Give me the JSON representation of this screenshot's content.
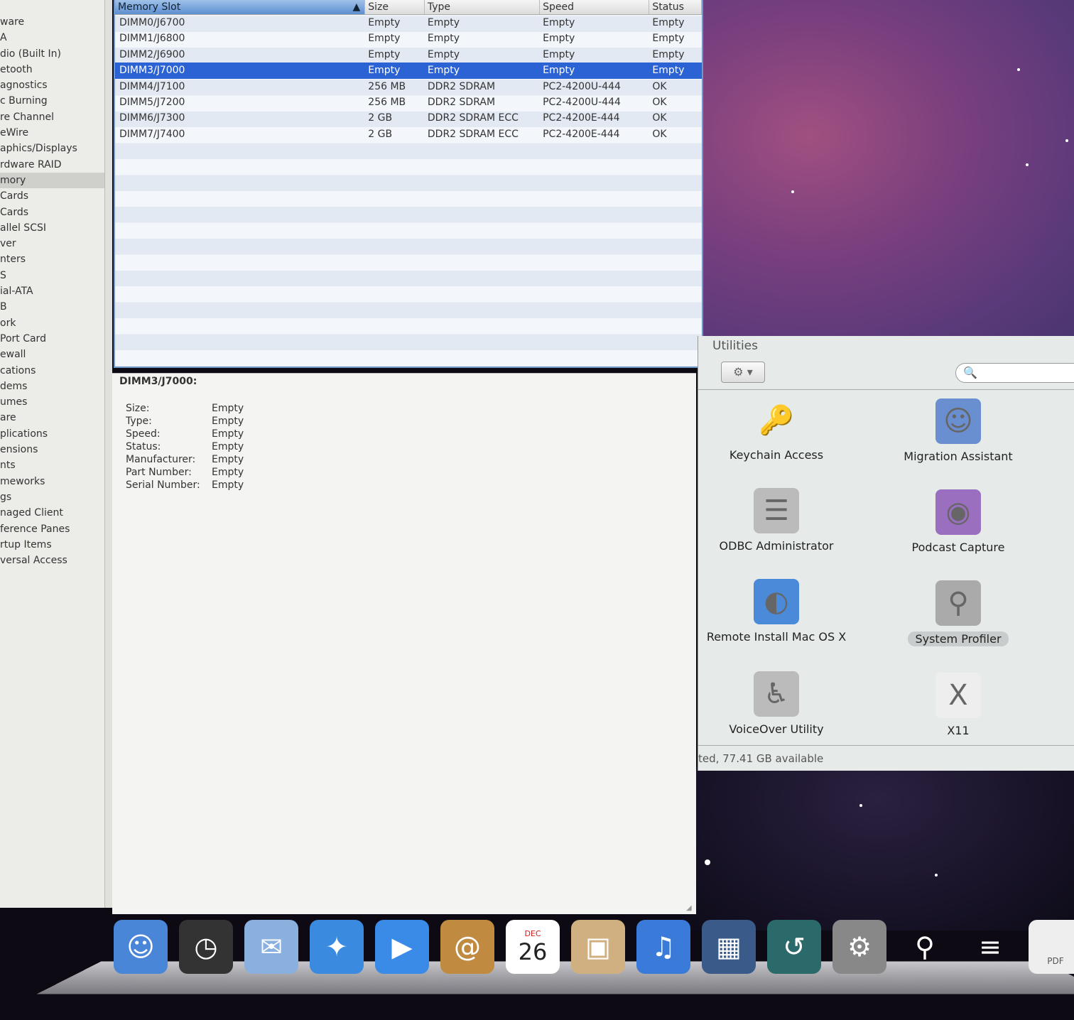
{
  "sidebar": {
    "items": [
      "ware",
      "A",
      "dio (Built In)",
      "etooth",
      "agnostics",
      "c Burning",
      "re Channel",
      "eWire",
      "aphics/Displays",
      "rdware RAID",
      "mory",
      "Cards",
      "Cards",
      "allel SCSI",
      "ver",
      "nters",
      "S",
      "ial-ATA",
      "B",
      "ork",
      "Port Card",
      "ewall",
      "cations",
      "dems",
      "umes",
      "are",
      "plications",
      "ensions",
      "nts",
      "meworks",
      "gs",
      "naged Client",
      "ference Panes",
      "rtup Items",
      "versal Access"
    ],
    "selected": "mory"
  },
  "table": {
    "columns": [
      "Memory Slot",
      "Size",
      "Type",
      "Speed",
      "Status"
    ],
    "sort_icon": "sort-ascending-icon",
    "rows": [
      [
        "DIMM0/J6700",
        "Empty",
        "Empty",
        "Empty",
        "Empty"
      ],
      [
        "DIMM1/J6800",
        "Empty",
        "Empty",
        "Empty",
        "Empty"
      ],
      [
        "DIMM2/J6900",
        "Empty",
        "Empty",
        "Empty",
        "Empty"
      ],
      [
        "DIMM3/J7000",
        "Empty",
        "Empty",
        "Empty",
        "Empty"
      ],
      [
        "DIMM4/J7100",
        "256 MB",
        "DDR2 SDRAM",
        "PC2-4200U-444",
        "OK"
      ],
      [
        "DIMM5/J7200",
        "256 MB",
        "DDR2 SDRAM",
        "PC2-4200U-444",
        "OK"
      ],
      [
        "DIMM6/J7300",
        "2 GB",
        "DDR2 SDRAM ECC",
        "PC2-4200E-444",
        "OK"
      ],
      [
        "DIMM7/J7400",
        "2 GB",
        "DDR2 SDRAM ECC",
        "PC2-4200E-444",
        "OK"
      ]
    ],
    "selected_row": 3
  },
  "detail": {
    "title": "DIMM3/J7000:",
    "fields": [
      [
        "Size:",
        "Empty"
      ],
      [
        "Type:",
        "Empty"
      ],
      [
        "Speed:",
        "Empty"
      ],
      [
        "Status:",
        "Empty"
      ],
      [
        "Manufacturer:",
        "Empty"
      ],
      [
        "Part Number:",
        "Empty"
      ],
      [
        "Serial Number:",
        "Empty"
      ]
    ]
  },
  "utilities": {
    "title": "Utilities",
    "apps": [
      "Keychain Access",
      "Migration Assistant",
      "ODBC Administrator",
      "Podcast Capture",
      "Remote Install Mac OS X",
      "System Profiler",
      "VoiceOver Utility",
      "X11"
    ],
    "selected": "System Profiler",
    "status": "ted, 77.41 GB available"
  },
  "dock": {
    "items": [
      "Finder",
      "Dashboard",
      "Mail",
      "Safari",
      "iChat",
      "Address Book",
      "iCal",
      "iPhoto",
      "iTunes",
      "Spaces",
      "Time Machine",
      "System Preferences",
      "System Profiler",
      "Stacks",
      "PDF document"
    ],
    "ical_month": "DEC",
    "ical_day": "26",
    "pdf_label": "PDF"
  },
  "colors": {
    "selection": "#2c63d4",
    "header_sorted": "#6f98c8"
  }
}
